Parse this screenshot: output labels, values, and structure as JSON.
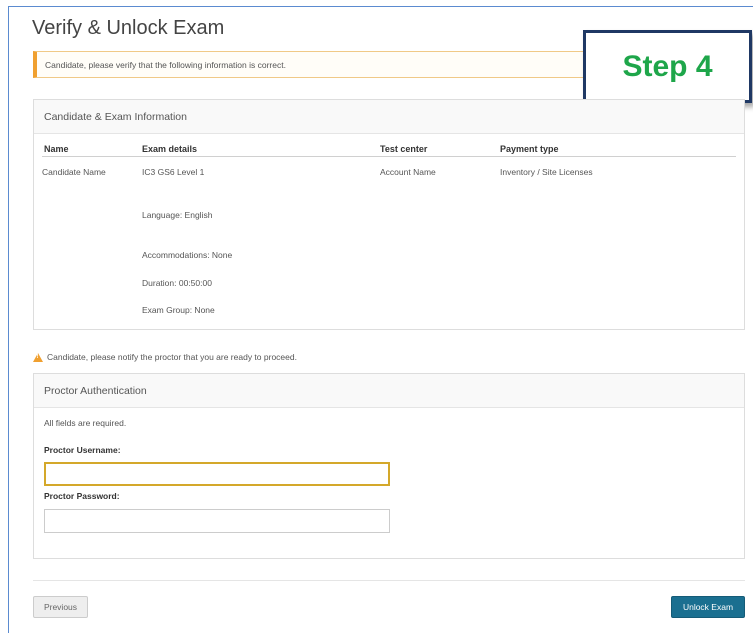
{
  "page": {
    "title": "Verify & Unlock Exam",
    "verify_alert": "Candidate, please verify that the following information is correct.",
    "step_badge": "Step 4"
  },
  "info_panel": {
    "heading": "Candidate & Exam Information",
    "columns": [
      "Name",
      "Exam details",
      "Test center",
      "Payment type"
    ],
    "row": {
      "name": "Candidate Name",
      "exam": "IC3 GS6 Level 1",
      "language": "Language: English",
      "accommodations": "Accommodations: None",
      "duration": "Duration: 00:50:00",
      "exam_group": "Exam Group: None",
      "test_center": "Account Name",
      "payment_type": "Inventory / Site Licenses"
    }
  },
  "notice": {
    "text": "Candidate, please notify the proctor that you are ready to proceed.",
    "icon": "warning-icon"
  },
  "auth_panel": {
    "heading": "Proctor Authentication",
    "required_text": "All fields are required.",
    "username_label": "Proctor Username:",
    "username_value": "",
    "password_label": "Proctor Password:",
    "password_value": ""
  },
  "footer": {
    "previous_label": "Previous",
    "unlock_label": "Unlock Exam"
  },
  "colors": {
    "accent": "#1a6f90",
    "warning": "#f0a030",
    "step_text": "#1ea64a",
    "focus_border": "#d4a82a"
  }
}
